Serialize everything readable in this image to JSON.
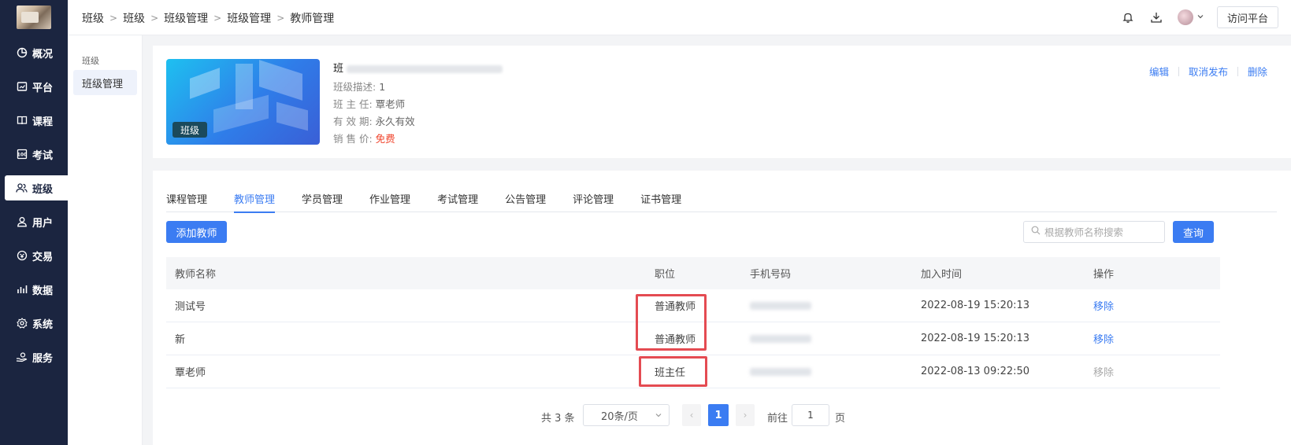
{
  "sidebar": {
    "items": [
      {
        "label": "概况",
        "icon": "pie-chart-icon"
      },
      {
        "label": "平台",
        "icon": "platform-icon"
      },
      {
        "label": "课程",
        "icon": "book-icon"
      },
      {
        "label": "考试",
        "icon": "exam-icon"
      },
      {
        "label": "班级",
        "icon": "class-users-icon",
        "active": true
      },
      {
        "label": "用户",
        "icon": "user-icon"
      },
      {
        "label": "交易",
        "icon": "trade-icon"
      },
      {
        "label": "数据",
        "icon": "bar-chart-icon"
      },
      {
        "label": "系统",
        "icon": "gear-icon"
      },
      {
        "label": "服务",
        "icon": "service-hand-icon"
      }
    ]
  },
  "header": {
    "breadcrumb": [
      "班级",
      "班级",
      "班级管理",
      "班级管理",
      "教师管理"
    ],
    "visit_label": "访问平台"
  },
  "subnav": {
    "group": "班级",
    "item": "班级管理"
  },
  "course": {
    "tag": "班级",
    "title_prefix": "班",
    "desc_label": "班级描述:",
    "desc_value": "1",
    "head_label": "班 主 任:",
    "head_value": "覃老师",
    "valid_label": "有 效 期:",
    "valid_value": "永久有效",
    "price_label": "销 售 价:",
    "price_value": "免费",
    "actions": {
      "edit": "编辑",
      "unpublish": "取消发布",
      "delete": "删除"
    }
  },
  "tabs": [
    "课程管理",
    "教师管理",
    "学员管理",
    "作业管理",
    "考试管理",
    "公告管理",
    "评论管理",
    "证书管理"
  ],
  "active_tab": 1,
  "toolbar": {
    "add_label": "添加教师",
    "search_placeholder": "根据教师名称搜索",
    "query_label": "查询"
  },
  "table": {
    "columns": [
      "教师名称",
      "职位",
      "手机号码",
      "加入时间",
      "操作"
    ],
    "rows": [
      {
        "name": "测试号",
        "role": "普通教师",
        "joined": "2022-08-19 15:20:13",
        "action": "移除",
        "disabled": false
      },
      {
        "name": "新",
        "role": "普通教师",
        "joined": "2022-08-19 15:20:13",
        "action": "移除",
        "disabled": false
      },
      {
        "name": "覃老师",
        "role": "班主任",
        "joined": "2022-08-13 09:22:50",
        "action": "移除",
        "disabled": true
      }
    ]
  },
  "pagination": {
    "total": "共 3 条",
    "page_size": "20条/页",
    "current": "1",
    "goto_prefix": "前往",
    "goto_value": "1",
    "goto_suffix": "页"
  },
  "colors": {
    "sidebar_bg": "#1b2540",
    "accent": "#3b7cf2",
    "highlight_box": "#e44b52",
    "price_free": "#f0432b"
  }
}
